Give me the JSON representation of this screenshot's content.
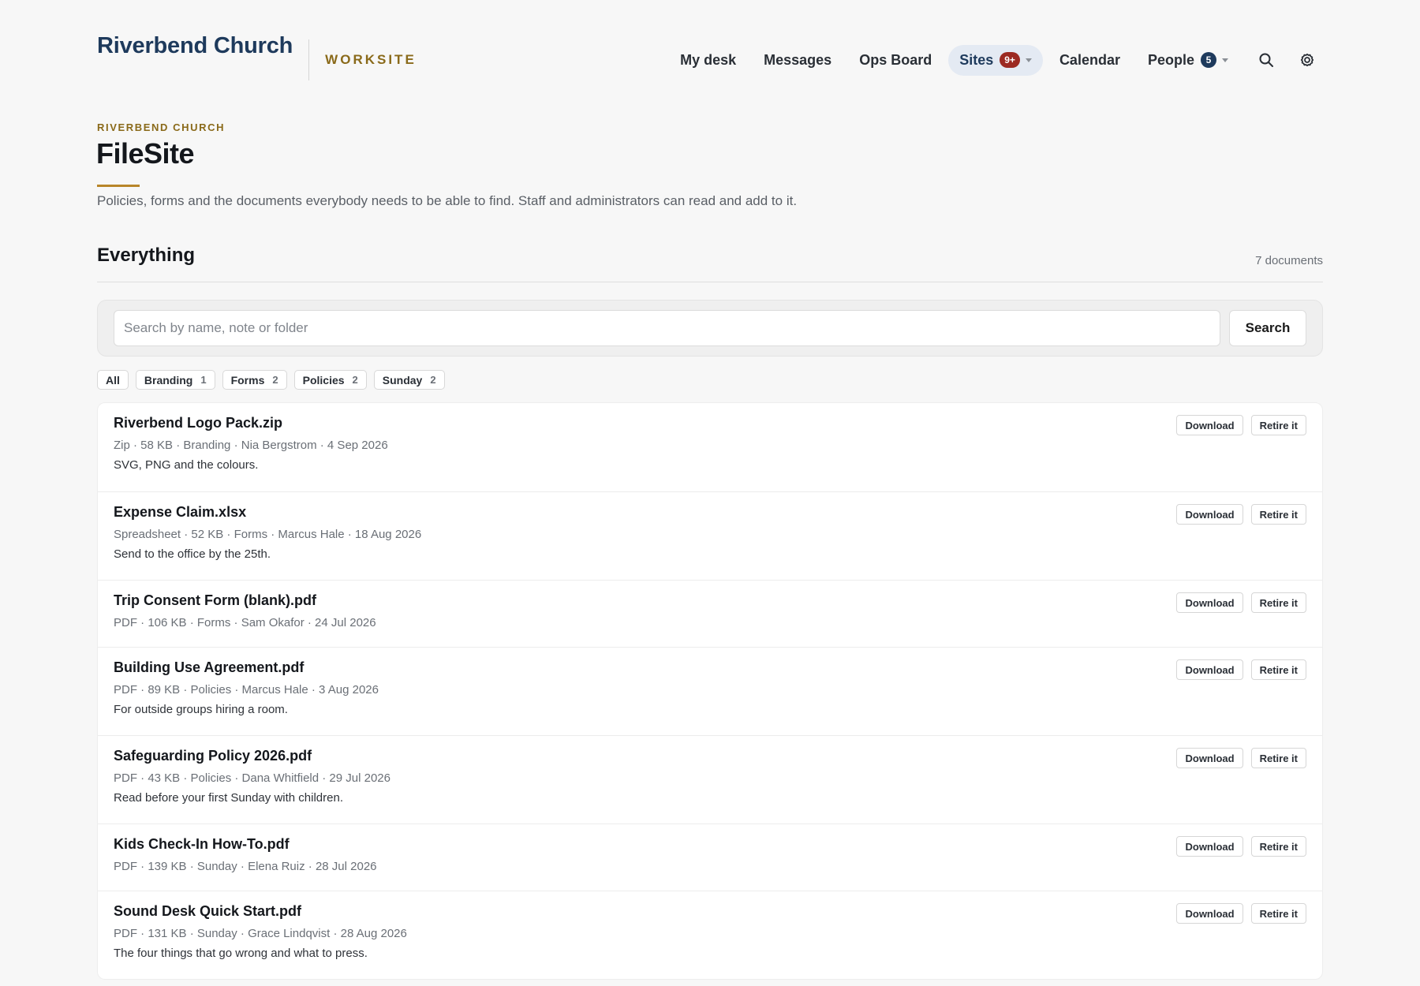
{
  "header": {
    "brand": "Riverbend Church",
    "subtitle": "WORKSITE",
    "nav": [
      {
        "label": "My desk"
      },
      {
        "label": "Messages"
      },
      {
        "label": "Ops Board"
      },
      {
        "label": "Sites",
        "badge": "9+",
        "active": true
      },
      {
        "label": "Calendar"
      },
      {
        "label": "People",
        "badge": "5"
      }
    ],
    "icons": [
      "search-icon",
      "gear-icon"
    ]
  },
  "page": {
    "eyebrow": "RIVERBEND CHURCH",
    "title": "FileSite",
    "description": "Policies, forms and the documents everybody needs to be able to find. Staff and administrators can read and add to it."
  },
  "section": {
    "title": "Everything",
    "count_label": "7 documents"
  },
  "search": {
    "placeholder": "Search by name, note or folder",
    "value": "",
    "button_label": "Search"
  },
  "filters": [
    {
      "label": "All",
      "count": ""
    },
    {
      "label": "Branding",
      "count": "1"
    },
    {
      "label": "Forms",
      "count": "2"
    },
    {
      "label": "Policies",
      "count": "2"
    },
    {
      "label": "Sunday",
      "count": "2"
    }
  ],
  "actions": {
    "download_label": "Download",
    "retire_label": "Retire it"
  },
  "documents": [
    {
      "name": "Riverbend Logo Pack.zip",
      "meta": "Zip · 58 KB · Branding · Nia Bergstrom · 4 Sep 2026",
      "note": "SVG, PNG and the colours."
    },
    {
      "name": "Expense Claim.xlsx",
      "meta": "Spreadsheet · 52 KB · Forms · Marcus Hale · 18 Aug 2026",
      "note": "Send to the office by the 25th."
    },
    {
      "name": "Trip Consent Form (blank).pdf",
      "meta": "PDF · 106 KB · Forms · Sam Okafor · 24 Jul 2026",
      "note": ""
    },
    {
      "name": "Building Use Agreement.pdf",
      "meta": "PDF · 89 KB · Policies · Marcus Hale · 3 Aug 2026",
      "note": "For outside groups hiring a room."
    },
    {
      "name": "Safeguarding Policy 2026.pdf",
      "meta": "PDF · 43 KB · Policies · Dana Whitfield · 29 Jul 2026",
      "note": "Read before your first Sunday with children."
    },
    {
      "name": "Kids Check-In How-To.pdf",
      "meta": "PDF · 139 KB · Sunday · Elena Ruiz · 28 Jul 2026",
      "note": ""
    },
    {
      "name": "Sound Desk Quick Start.pdf",
      "meta": "PDF · 131 KB · Sunday · Grace Lindqvist · 28 Aug 2026",
      "note": "The four things that go wrong and what to press."
    }
  ],
  "colors": {
    "brand": "#1e3a5c",
    "accent_gold": "#8a6a1a",
    "badge_red": "#9c2a22",
    "active_nav_bg": "#e4eaf3"
  }
}
